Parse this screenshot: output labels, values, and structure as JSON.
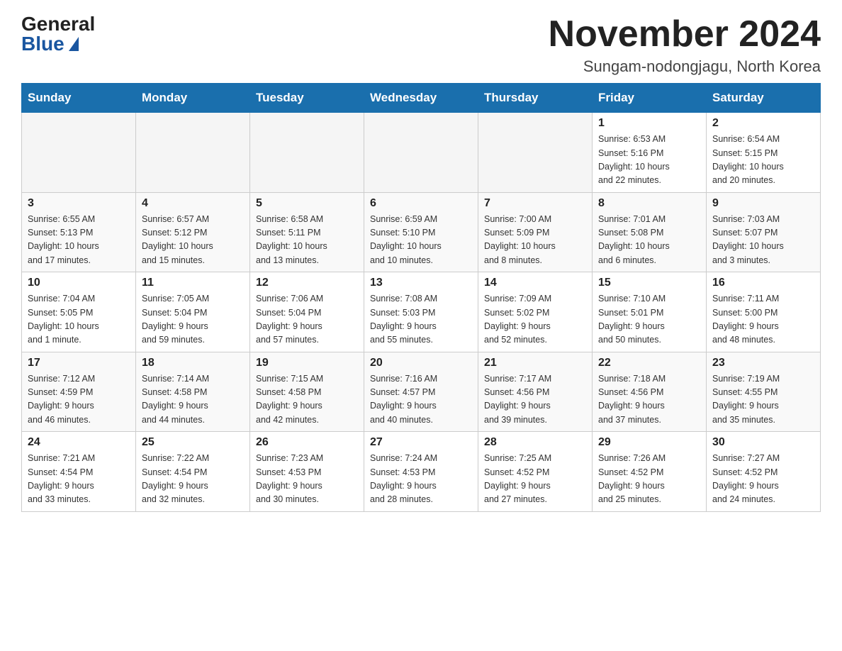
{
  "header": {
    "logo_general": "General",
    "logo_blue": "Blue",
    "month_title": "November 2024",
    "location": "Sungam-nodongjagu, North Korea"
  },
  "weekdays": [
    "Sunday",
    "Monday",
    "Tuesday",
    "Wednesday",
    "Thursday",
    "Friday",
    "Saturday"
  ],
  "weeks": [
    [
      {
        "day": "",
        "info": ""
      },
      {
        "day": "",
        "info": ""
      },
      {
        "day": "",
        "info": ""
      },
      {
        "day": "",
        "info": ""
      },
      {
        "day": "",
        "info": ""
      },
      {
        "day": "1",
        "info": "Sunrise: 6:53 AM\nSunset: 5:16 PM\nDaylight: 10 hours\nand 22 minutes."
      },
      {
        "day": "2",
        "info": "Sunrise: 6:54 AM\nSunset: 5:15 PM\nDaylight: 10 hours\nand 20 minutes."
      }
    ],
    [
      {
        "day": "3",
        "info": "Sunrise: 6:55 AM\nSunset: 5:13 PM\nDaylight: 10 hours\nand 17 minutes."
      },
      {
        "day": "4",
        "info": "Sunrise: 6:57 AM\nSunset: 5:12 PM\nDaylight: 10 hours\nand 15 minutes."
      },
      {
        "day": "5",
        "info": "Sunrise: 6:58 AM\nSunset: 5:11 PM\nDaylight: 10 hours\nand 13 minutes."
      },
      {
        "day": "6",
        "info": "Sunrise: 6:59 AM\nSunset: 5:10 PM\nDaylight: 10 hours\nand 10 minutes."
      },
      {
        "day": "7",
        "info": "Sunrise: 7:00 AM\nSunset: 5:09 PM\nDaylight: 10 hours\nand 8 minutes."
      },
      {
        "day": "8",
        "info": "Sunrise: 7:01 AM\nSunset: 5:08 PM\nDaylight: 10 hours\nand 6 minutes."
      },
      {
        "day": "9",
        "info": "Sunrise: 7:03 AM\nSunset: 5:07 PM\nDaylight: 10 hours\nand 3 minutes."
      }
    ],
    [
      {
        "day": "10",
        "info": "Sunrise: 7:04 AM\nSunset: 5:05 PM\nDaylight: 10 hours\nand 1 minute."
      },
      {
        "day": "11",
        "info": "Sunrise: 7:05 AM\nSunset: 5:04 PM\nDaylight: 9 hours\nand 59 minutes."
      },
      {
        "day": "12",
        "info": "Sunrise: 7:06 AM\nSunset: 5:04 PM\nDaylight: 9 hours\nand 57 minutes."
      },
      {
        "day": "13",
        "info": "Sunrise: 7:08 AM\nSunset: 5:03 PM\nDaylight: 9 hours\nand 55 minutes."
      },
      {
        "day": "14",
        "info": "Sunrise: 7:09 AM\nSunset: 5:02 PM\nDaylight: 9 hours\nand 52 minutes."
      },
      {
        "day": "15",
        "info": "Sunrise: 7:10 AM\nSunset: 5:01 PM\nDaylight: 9 hours\nand 50 minutes."
      },
      {
        "day": "16",
        "info": "Sunrise: 7:11 AM\nSunset: 5:00 PM\nDaylight: 9 hours\nand 48 minutes."
      }
    ],
    [
      {
        "day": "17",
        "info": "Sunrise: 7:12 AM\nSunset: 4:59 PM\nDaylight: 9 hours\nand 46 minutes."
      },
      {
        "day": "18",
        "info": "Sunrise: 7:14 AM\nSunset: 4:58 PM\nDaylight: 9 hours\nand 44 minutes."
      },
      {
        "day": "19",
        "info": "Sunrise: 7:15 AM\nSunset: 4:58 PM\nDaylight: 9 hours\nand 42 minutes."
      },
      {
        "day": "20",
        "info": "Sunrise: 7:16 AM\nSunset: 4:57 PM\nDaylight: 9 hours\nand 40 minutes."
      },
      {
        "day": "21",
        "info": "Sunrise: 7:17 AM\nSunset: 4:56 PM\nDaylight: 9 hours\nand 39 minutes."
      },
      {
        "day": "22",
        "info": "Sunrise: 7:18 AM\nSunset: 4:56 PM\nDaylight: 9 hours\nand 37 minutes."
      },
      {
        "day": "23",
        "info": "Sunrise: 7:19 AM\nSunset: 4:55 PM\nDaylight: 9 hours\nand 35 minutes."
      }
    ],
    [
      {
        "day": "24",
        "info": "Sunrise: 7:21 AM\nSunset: 4:54 PM\nDaylight: 9 hours\nand 33 minutes."
      },
      {
        "day": "25",
        "info": "Sunrise: 7:22 AM\nSunset: 4:54 PM\nDaylight: 9 hours\nand 32 minutes."
      },
      {
        "day": "26",
        "info": "Sunrise: 7:23 AM\nSunset: 4:53 PM\nDaylight: 9 hours\nand 30 minutes."
      },
      {
        "day": "27",
        "info": "Sunrise: 7:24 AM\nSunset: 4:53 PM\nDaylight: 9 hours\nand 28 minutes."
      },
      {
        "day": "28",
        "info": "Sunrise: 7:25 AM\nSunset: 4:52 PM\nDaylight: 9 hours\nand 27 minutes."
      },
      {
        "day": "29",
        "info": "Sunrise: 7:26 AM\nSunset: 4:52 PM\nDaylight: 9 hours\nand 25 minutes."
      },
      {
        "day": "30",
        "info": "Sunrise: 7:27 AM\nSunset: 4:52 PM\nDaylight: 9 hours\nand 24 minutes."
      }
    ]
  ]
}
